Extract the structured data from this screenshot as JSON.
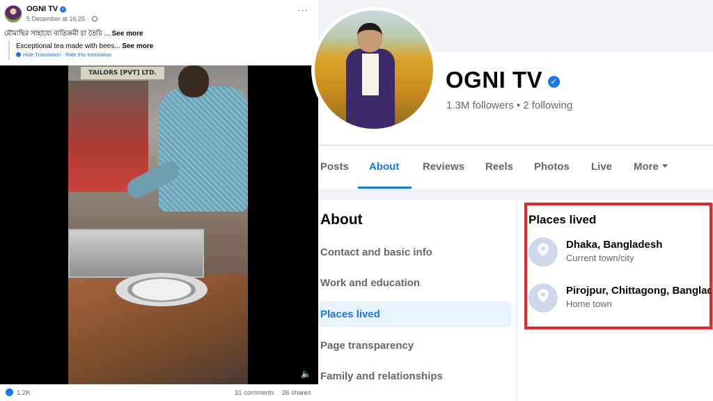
{
  "post": {
    "author": "OGNI TV",
    "timestamp": "5 December at 16:25",
    "text_original": "মৌমাছির সাহায্যে ব্যতিক্রমী চা তৈরি ...",
    "see_more": "See more",
    "translated_text": "Exceptional tea made with bees...",
    "translated_see_more": "See more",
    "hide_translation": "Hide Translation",
    "separator": "·",
    "rate_translation": "Rate this translation",
    "video_sign_text": "TAILORS [PVT] LTD.",
    "reactions_count": "1.2K",
    "comments_label": "31 comments",
    "shares_label": "26 shares"
  },
  "profile": {
    "page_name": "OGNI TV",
    "followers_text": "1.3M followers",
    "bullet": " • ",
    "following_text": "2 following",
    "tabs": [
      "Posts",
      "About",
      "Reviews",
      "Reels",
      "Photos",
      "Live",
      "More"
    ],
    "active_tab": "About",
    "about": {
      "title": "About",
      "items": [
        "Contact and basic info",
        "Work and education",
        "Places lived",
        "Page transparency",
        "Family and relationships"
      ],
      "active_item": "Places lived"
    },
    "places": {
      "title": "Places lived",
      "entries": [
        {
          "name": "Dhaka, Bangladesh",
          "type": "Current town/city"
        },
        {
          "name": "Pirojpur, Chittagong, Bangladesh",
          "type": "Home town"
        }
      ]
    }
  },
  "colors": {
    "accent": "#1877f2",
    "highlight_border": "#e8262a",
    "secondary_text": "#65676b"
  }
}
